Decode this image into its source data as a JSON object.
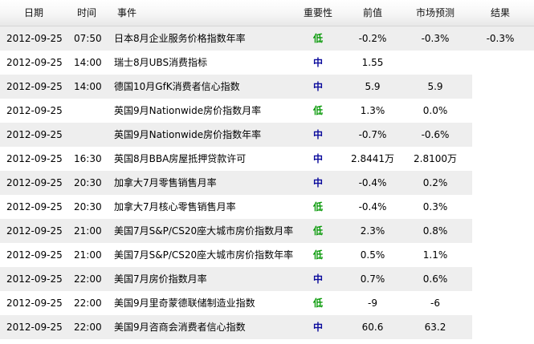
{
  "header": {
    "date": "日期",
    "time": "时间",
    "event": "事件",
    "importance": "重要性",
    "previous": "前值",
    "forecast": "市场预测",
    "actual": "结果"
  },
  "colors": {
    "low": "#0a9a0a",
    "medium": "#0b0b9c",
    "row_alt": "#eeeeee"
  },
  "rows": [
    {
      "date": "2012-09-25",
      "time": "07:50",
      "event": "日本8月企业服务价格指数年率",
      "importance": "低",
      "level": "low",
      "previous": "-0.2%",
      "forecast": "-0.3%",
      "actual": "-0.3%"
    },
    {
      "date": "2012-09-25",
      "time": "14:00",
      "event": "瑞士8月UBS消费指标",
      "importance": "中",
      "level": "medium",
      "previous": "1.55",
      "forecast": "",
      "actual": ""
    },
    {
      "date": "2012-09-25",
      "time": "14:00",
      "event": "德国10月GfK消费者信心指数",
      "importance": "中",
      "level": "medium",
      "previous": "5.9",
      "forecast": "5.9",
      "actual": ""
    },
    {
      "date": "2012-09-25",
      "time": "",
      "event": "英国9月Nationwide房价指数月率",
      "importance": "低",
      "level": "low",
      "previous": "1.3%",
      "forecast": "0.0%",
      "actual": ""
    },
    {
      "date": "2012-09-25",
      "time": "",
      "event": "英国9月Nationwide房价指数年率",
      "importance": "中",
      "level": "medium",
      "previous": "-0.7%",
      "forecast": "-0.6%",
      "actual": ""
    },
    {
      "date": "2012-09-25",
      "time": "16:30",
      "event": "英国8月BBA房屋抵押贷款许可",
      "importance": "中",
      "level": "medium",
      "previous": "2.8441万",
      "forecast": "2.8100万",
      "actual": ""
    },
    {
      "date": "2012-09-25",
      "time": "20:30",
      "event": "加拿大7月零售销售月率",
      "importance": "中",
      "level": "medium",
      "previous": "-0.4%",
      "forecast": "0.2%",
      "actual": ""
    },
    {
      "date": "2012-09-25",
      "time": "20:30",
      "event": "加拿大7月核心零售销售月率",
      "importance": "低",
      "level": "low",
      "previous": "-0.4%",
      "forecast": "0.3%",
      "actual": ""
    },
    {
      "date": "2012-09-25",
      "time": "21:00",
      "event": "美国7月S&P/CS20座大城市房价指数月率",
      "importance": "低",
      "level": "low",
      "previous": "2.3%",
      "forecast": "0.8%",
      "actual": ""
    },
    {
      "date": "2012-09-25",
      "time": "21:00",
      "event": "美国7月S&P/CS20座大城市房价指数年率",
      "importance": "低",
      "level": "low",
      "previous": "0.5%",
      "forecast": "1.1%",
      "actual": ""
    },
    {
      "date": "2012-09-25",
      "time": "22:00",
      "event": "美国7月房价指数月率",
      "importance": "中",
      "level": "medium",
      "previous": "0.7%",
      "forecast": "0.6%",
      "actual": ""
    },
    {
      "date": "2012-09-25",
      "time": "22:00",
      "event": "美国9月里奇蒙德联储制造业指数",
      "importance": "低",
      "level": "low",
      "previous": "-9",
      "forecast": "-6",
      "actual": ""
    },
    {
      "date": "2012-09-25",
      "time": "22:00",
      "event": "美国9月咨商会消费者信心指数",
      "importance": "中",
      "level": "medium",
      "previous": "60.6",
      "forecast": "63.2",
      "actual": ""
    }
  ]
}
